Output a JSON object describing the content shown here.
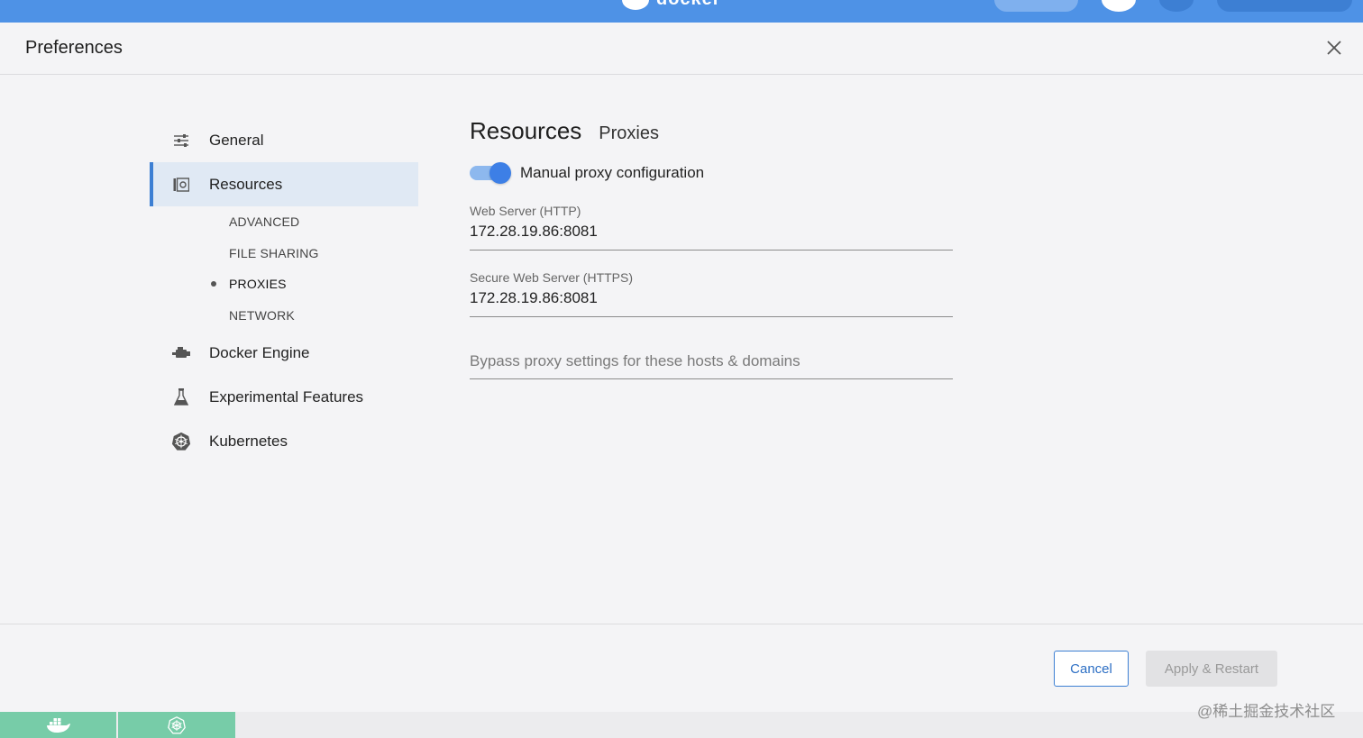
{
  "topbar": {
    "brand": "docker"
  },
  "header": {
    "title": "Preferences"
  },
  "sidebar": {
    "items": [
      {
        "label": "General",
        "icon": "sliders-icon"
      },
      {
        "label": "Resources",
        "icon": "resources-icon",
        "active": true
      },
      {
        "label": "Docker Engine",
        "icon": "engine-icon"
      },
      {
        "label": "Experimental Features",
        "icon": "flask-icon"
      },
      {
        "label": "Kubernetes",
        "icon": "kubernetes-icon"
      }
    ],
    "sub_items": [
      {
        "label": "ADVANCED"
      },
      {
        "label": "FILE SHARING"
      },
      {
        "label": "PROXIES",
        "current": true
      },
      {
        "label": "NETWORK"
      }
    ]
  },
  "main": {
    "section": "Resources",
    "subsection": "Proxies",
    "toggle": {
      "label": "Manual proxy configuration",
      "on": true
    },
    "http": {
      "label": "Web Server (HTTP)",
      "value": "172.28.19.86:8081"
    },
    "https": {
      "label": "Secure Web Server (HTTPS)",
      "value": "172.28.19.86:8081"
    },
    "bypass": {
      "placeholder": "Bypass proxy settings for these hosts & domains",
      "value": ""
    }
  },
  "footer": {
    "cancel_label": "Cancel",
    "apply_label": "Apply & Restart"
  },
  "watermark": "@稀土掘金技术社区",
  "colors": {
    "accent": "#3d7fd3",
    "topbar": "#4e92e6",
    "status_green": "#77cca8"
  }
}
